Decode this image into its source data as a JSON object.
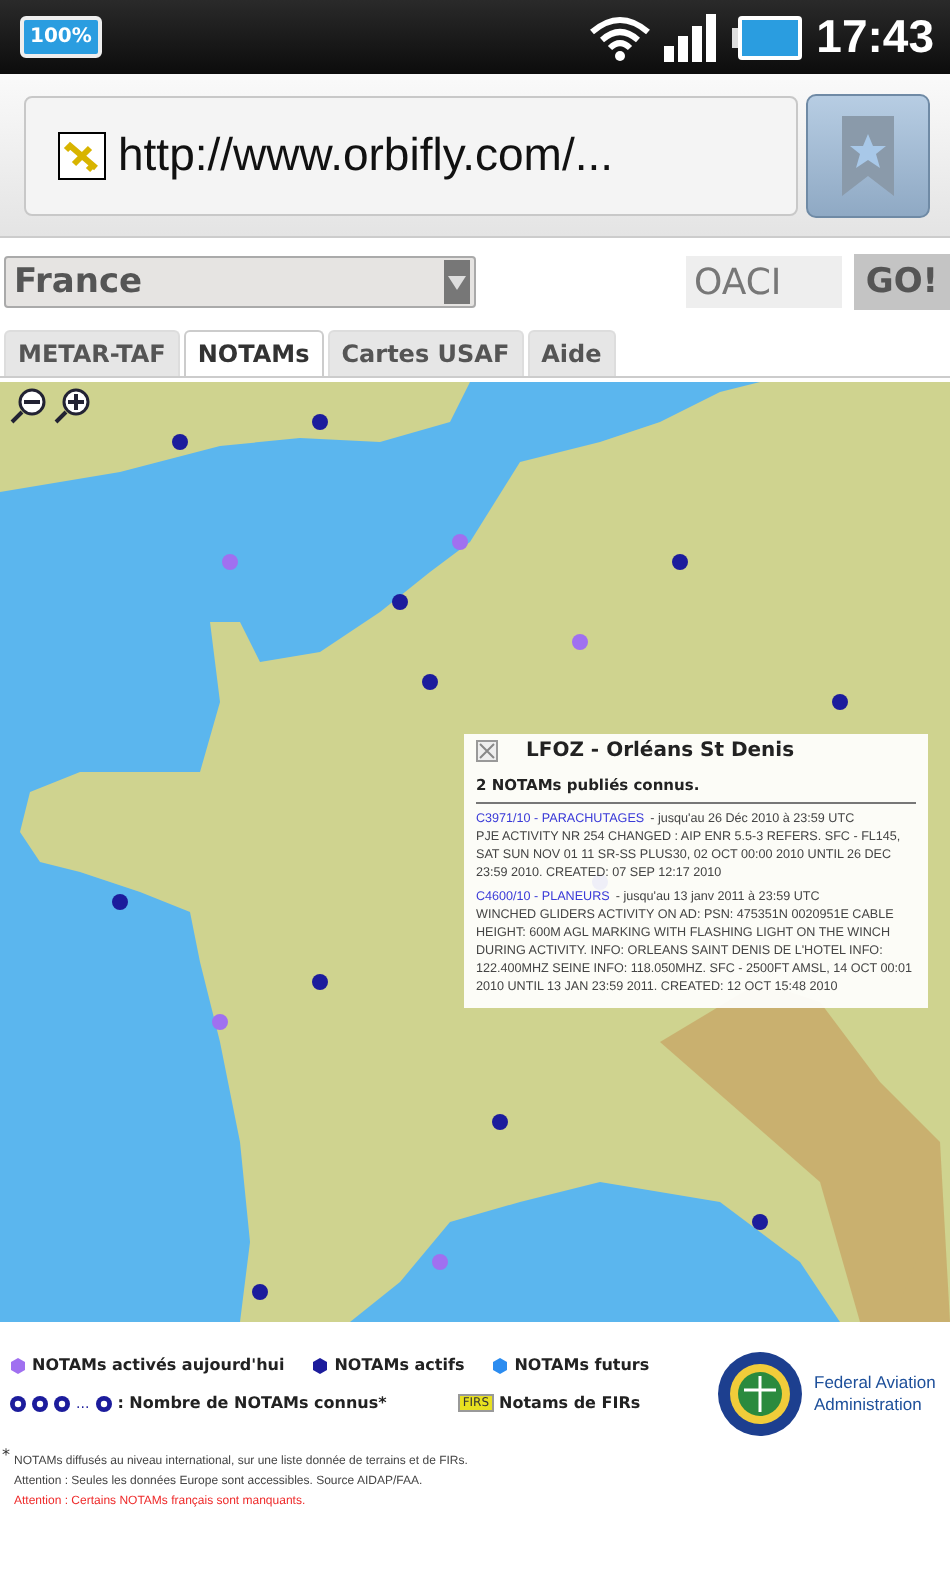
{
  "status_bar": {
    "battery_badge": "100%",
    "time": "17:43"
  },
  "browser": {
    "url": "http://www.orbifly.com/..."
  },
  "toolbar": {
    "country": "France",
    "icao_placeholder": "OACI",
    "go_button": "GO!"
  },
  "tabs": [
    {
      "label": "METAR-TAF",
      "selected": false
    },
    {
      "label": "NOTAMs",
      "selected": true
    },
    {
      "label": "Cartes USAF",
      "selected": false
    },
    {
      "label": "Aide",
      "selected": false
    }
  ],
  "popup": {
    "title": "LFOZ - Orléans St Denis",
    "summary": "2 NOTAMs publiés connus.",
    "notams": [
      {
        "link": "C3971/10 - PARACHUTAGES",
        "validity": "- jusqu'au 26 Déc 2010 à 23:59 UTC",
        "text": "PJE ACTIVITY NR 254 CHANGED : AIP ENR 5.5-3 REFERS. SFC - FL145, SAT SUN NOV 01 11 SR-SS PLUS30, 02 OCT 00:00 2010 UNTIL 26 DEC 23:59 2010. CREATED: 07 SEP 12:17 2010"
      },
      {
        "link": "C4600/10 - PLANEURS",
        "validity": "- jusqu'au 13 janv 2011 à 23:59 UTC",
        "text": "WINCHED GLIDERS ACTIVITY ON AD: PSN: 475351N 0020951E CABLE HEIGHT: 600M AGL MARKING WITH FLASHING LIGHT ON THE WINCH DURING ACTIVITY. INFO: ORLEANS SAINT DENIS DE L'HOTEL INFO: 122.400MHZ SEINE INFO: 118.050MHZ. SFC - 2500FT AMSL, 14 OCT 00:01 2010 UNTIL 13 JAN 23:59 2011. CREATED: 12 OCT 15:48 2010"
      }
    ]
  },
  "legend": {
    "items": [
      {
        "label": "NOTAMs activés aujourd'hui",
        "color": "#a070f0"
      },
      {
        "label": "NOTAMs actifs",
        "color": "#1c1c9c"
      },
      {
        "label": "NOTAMs futurs",
        "color": "#2b8cf0"
      }
    ],
    "count_ellipsis": "...",
    "count_label": ": Nombre de NOTAMs connus*",
    "fir_badge": "FIRS",
    "fir_label": "Notams de FIRs"
  },
  "faa": {
    "name": "Federal Aviation Administration"
  },
  "footnotes": {
    "mark": "*",
    "lines": [
      {
        "kind": "normal",
        "text": "NOTAMs diffusés au niveau international, sur une liste donnée de terrains et de FIRs."
      },
      {
        "kind": "normal",
        "text": "Attention : Seules les données Europe sont accessibles. Source AIDAP/FAA."
      },
      {
        "kind": "warning",
        "text": "Attention : Certains NOTAMs français sont manquants."
      }
    ]
  }
}
